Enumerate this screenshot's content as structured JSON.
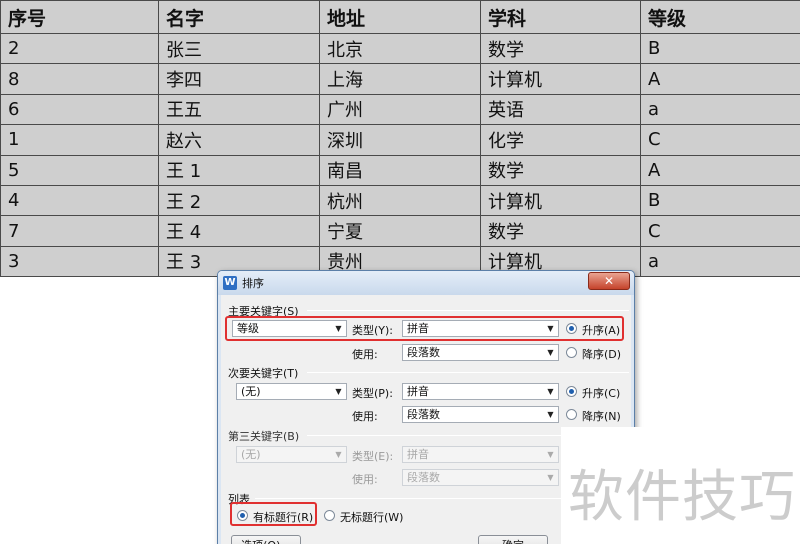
{
  "table": {
    "headers": [
      "序号",
      "名字",
      "地址",
      "学科",
      "等级"
    ],
    "rows": [
      [
        "2",
        "张三",
        "北京",
        "数学",
        "B"
      ],
      [
        "8",
        "李四",
        "上海",
        "计算机",
        "A"
      ],
      [
        "6",
        "王五",
        "广州",
        "英语",
        "a"
      ],
      [
        "1",
        "赵六",
        "深圳",
        "化学",
        "C"
      ],
      [
        "5",
        "王 1",
        "南昌",
        "数学",
        "A"
      ],
      [
        "4",
        "王 2",
        "杭州",
        "计算机",
        "B"
      ],
      [
        "7",
        "王 4",
        "宁夏",
        "数学",
        "C"
      ],
      [
        "3",
        "王 3",
        "贵州",
        "计算机",
        "a"
      ]
    ]
  },
  "dialog": {
    "app_icon": "W",
    "title": "排序",
    "close": "✕",
    "primary": {
      "title": "主要关键字(S)",
      "field": "等级",
      "type_label": "类型(Y):",
      "type_value": "拼音",
      "use_label": "使用:",
      "use_value": "段落数",
      "asc_label": "升序(A)",
      "desc_label": "降序(D)"
    },
    "secondary": {
      "title": "次要关键字(T)",
      "field": "(无)",
      "type_label": "类型(P):",
      "type_value": "拼音",
      "use_label": "使用:",
      "use_value": "段落数",
      "asc_label": "升序(C)",
      "desc_label": "降序(N)"
    },
    "tertiary": {
      "title": "第三关键字(B)",
      "field": "(无)",
      "type_label": "类型(E):",
      "type_value": "拼音",
      "use_label": "使用:",
      "use_value": "段落数"
    },
    "list": {
      "title": "列表",
      "has_header": "有标题行(R)",
      "no_header": "无标题行(W)"
    },
    "options_button": "选项(O)...",
    "ok_button": "确定"
  },
  "watermark": "软件技巧",
  "colors": {
    "highlight": "#e03030",
    "table_bg": "#cfcfcf",
    "radio_dot": "#1f5fae"
  }
}
